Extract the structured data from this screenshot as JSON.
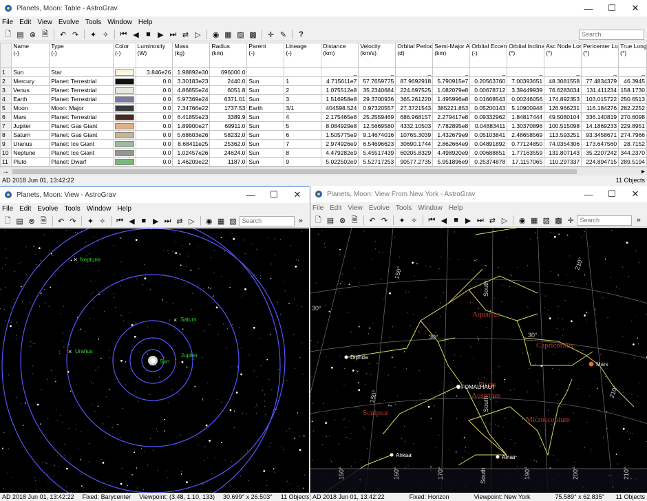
{
  "table_window": {
    "title": "Planets, Moon: Table - AstroGrav",
    "menu": [
      "File",
      "Edit",
      "View",
      "Evolve",
      "Tools",
      "Window",
      "Help"
    ],
    "search_placeholder": "Search",
    "headers": [
      {
        "name": "Name",
        "unit": "(-)"
      },
      {
        "name": "Type",
        "unit": "(-)"
      },
      {
        "name": "Color",
        "unit": "(-)"
      },
      {
        "name": "Luminosity",
        "unit": "(W)"
      },
      {
        "name": "Mass",
        "unit": "(kg)"
      },
      {
        "name": "Radius",
        "unit": "(km)"
      },
      {
        "name": "Parent",
        "unit": "(-)"
      },
      {
        "name": "Lineage",
        "unit": "(-)"
      },
      {
        "name": "Distance",
        "unit": "(km)"
      },
      {
        "name": "Velocity",
        "unit": "(km/s)"
      },
      {
        "name": "Orbital Period",
        "unit": "(d)"
      },
      {
        "name": "Semi-Major Axis",
        "unit": "(km)"
      },
      {
        "name": "Orbital Eccentricity",
        "unit": "(-)"
      },
      {
        "name": "Orbital Inclination",
        "unit": "(°)"
      },
      {
        "name": "Asc Node Longitude",
        "unit": "(°)"
      },
      {
        "name": "Pericenter Longitude",
        "unit": "(°)"
      },
      {
        "name": "True Longitude",
        "unit": "(°)"
      }
    ],
    "rows": [
      {
        "n": "1",
        "cells": [
          "Sun",
          "Star",
          "",
          "3.846e26",
          "1.98892e30",
          "696000.0",
          "",
          "",
          "_",
          "_",
          "_",
          "_",
          "_",
          "_",
          "_",
          "_",
          "_"
        ],
        "color": "#fff6e0"
      },
      {
        "n": "2",
        "cells": [
          "Mercury",
          "Planet: Terrestrial",
          "",
          "0.0",
          "3.30183e23",
          "2440.0",
          "Sun",
          "1",
          "4.715611e7",
          "57.7659775",
          "87.9692918",
          "5.790915e7",
          "0.20563760",
          "7.00393651",
          "48.3081558",
          "77.4834379",
          "46.3945"
        ],
        "color": "#111111"
      },
      {
        "n": "3",
        "cells": [
          "Venus",
          "Planet: Terrestrial",
          "",
          "0.0",
          "4.86855e24",
          "6051.8",
          "Sun",
          "2",
          "1.075512e8",
          "35.2340684",
          "224.697525",
          "1.082079e8",
          "0.00678712",
          "3.39449939",
          "76.6283034",
          "131.411234",
          "158.1730"
        ],
        "color": "#e8e8dc"
      },
      {
        "n": "4",
        "cells": [
          "Earth",
          "Planet: Terrestrial",
          "",
          "0.0",
          "5.97369e24",
          "6371.01",
          "Sun",
          "3",
          "1.516958e8",
          "29.3700936",
          "365.261220",
          "1.495996e8",
          "0.01668543",
          "0.00246056",
          "174.892353",
          "103.015722",
          "250.6513"
        ],
        "color": "#7a7aa8"
      },
      {
        "n": "5",
        "cells": [
          "Moon",
          "Moon: Major",
          "",
          "0.0",
          "7.34766e22",
          "1737.53",
          "Earth",
          "3/1",
          "404598.524",
          "0.97320557",
          "27.3721543",
          "385221.853",
          "0.05200143",
          "5.10900948",
          "126.966231",
          "116.184276",
          "282.2252"
        ],
        "color": "#3a3a3a"
      },
      {
        "n": "6",
        "cells": [
          "Mars",
          "Planet: Terrestrial",
          "",
          "0.0",
          "6.41855e23",
          "3389.9",
          "Sun",
          "4",
          "2.175465e8",
          "25.2559469",
          "686.968157",
          "2.279417e8",
          "0.09332962",
          "1.84817444",
          "49.5080104",
          "336.140819",
          "270.6098"
        ],
        "color": "#4a2a1a"
      },
      {
        "n": "7",
        "cells": [
          "Jupiter",
          "Planet: Gas Giant",
          "",
          "0.0",
          "1.89900e27",
          "69911.0",
          "Sun",
          "5",
          "8.084929e8",
          "12.5669580",
          "4332.10503",
          "7.782895e8",
          "0.04883411",
          "1.30370896",
          "100.515098",
          "14.1869233",
          "229.8951"
        ],
        "color": "#e0b088"
      },
      {
        "n": "8",
        "cells": [
          "Saturn",
          "Planet: Gas Giant",
          "",
          "0.0",
          "5.68603e26",
          "58232.0",
          "Sun",
          "6",
          "1.505775e9",
          "9.14674016",
          "10765.3039",
          "1.432679e9",
          "0.05103841",
          "2.48658569",
          "113.593251",
          "93.3458671",
          "274.7966"
        ],
        "color": "#c8b490"
      },
      {
        "n": "9",
        "cells": [
          "Uranus",
          "Planet: Ice Giant",
          "",
          "0.0",
          "8.68411e25",
          "25362.0",
          "Sun",
          "7",
          "2.974926e9",
          "6.54696623",
          "30690.1744",
          "2.862664e9",
          "0.04891892",
          "0.77124850",
          "74.0354306",
          "173.647560",
          "28.7152"
        ],
        "color": "#a0b8a0"
      },
      {
        "n": "10",
        "cells": [
          "Neptune",
          "Planet: Ice Giant",
          "",
          "0.0",
          "1.02457e26",
          "24624.0",
          "Sun",
          "8",
          "4.479282e9",
          "5.45517439",
          "60205.8329",
          "4.498920e9",
          "0.00688851",
          "1.77163559",
          "131.807143",
          "35.2207242",
          "344.2370"
        ],
        "color": "#909890"
      },
      {
        "n": "11",
        "cells": [
          "Pluto",
          "Planet: Dwarf",
          "",
          "0.0",
          "1.46209e22",
          "1187.0",
          "Sun",
          "9",
          "5.022502e9",
          "5.52717253",
          "90577.2735",
          "5.951896e9",
          "0.25374878",
          "17.1157065",
          "110.297337",
          "224.894715",
          "289.5194"
        ],
        "color": "#7cb87c"
      }
    ],
    "status_left": "AD 2018 Jun 01, 13:42:22",
    "status_right": "11 Objects"
  },
  "view_window": {
    "title": "Planets, Moon: View - AstroGrav",
    "menu": [
      "File",
      "Edit",
      "Evolve",
      "Tools",
      "Window",
      "Help"
    ],
    "search_placeholder": "Search",
    "labels": {
      "neptune": "Neptune",
      "saturn": "Saturn",
      "uranus": "Uranus",
      "jupiter": "Jupiter",
      "sun": "Sun"
    },
    "status_time": "AD 2018 Jun 01, 13:42:22",
    "status_fixed": "Fixed: Barycenter",
    "status_viewpoint": "Viewpoint: (3.48, 1.10, 133)",
    "status_angle": "30.699° x 26.503°",
    "status_objects": "11 Objects"
  },
  "ny_window": {
    "title": "Planets, Moon: View From New York - AstroGrav",
    "menu": [
      "File",
      "Edit",
      "View",
      "Evolve",
      "Tools",
      "Window",
      "Help"
    ],
    "search_placeholder": "Search",
    "constellations": {
      "aquarius": "Aquarius",
      "capricornus": "Capricornus",
      "piscis": "Piscis",
      "austrinus": "Austrinus",
      "sculptor": "Sculptor",
      "microscopium": "Microscopium"
    },
    "stars": {
      "diphda": "Diphda",
      "fomalhaut": "FOMALHAUT",
      "ankaa": "Ankaa",
      "alnair": "Alnair",
      "mars": "Mars"
    },
    "grid_labels": {
      "a150": "150°",
      "a210": "210°",
      "d30a": "30°",
      "d30b": "30°",
      "d30c": "30°",
      "south1": "South",
      "south2": "South",
      "a150b": "150°",
      "a210b": "210°"
    },
    "scale_labels": [
      "150°",
      "160°",
      "170°",
      "South",
      "190°",
      "200°",
      "210°"
    ],
    "status_time": "AD 2018 Jun 01, 13:42:22",
    "status_fixed": "Fixed: Horizon",
    "status_viewpoint": "Viewpoint: New York",
    "status_angle": "75.589° x 62.835°",
    "status_objects": "11 Objects"
  }
}
